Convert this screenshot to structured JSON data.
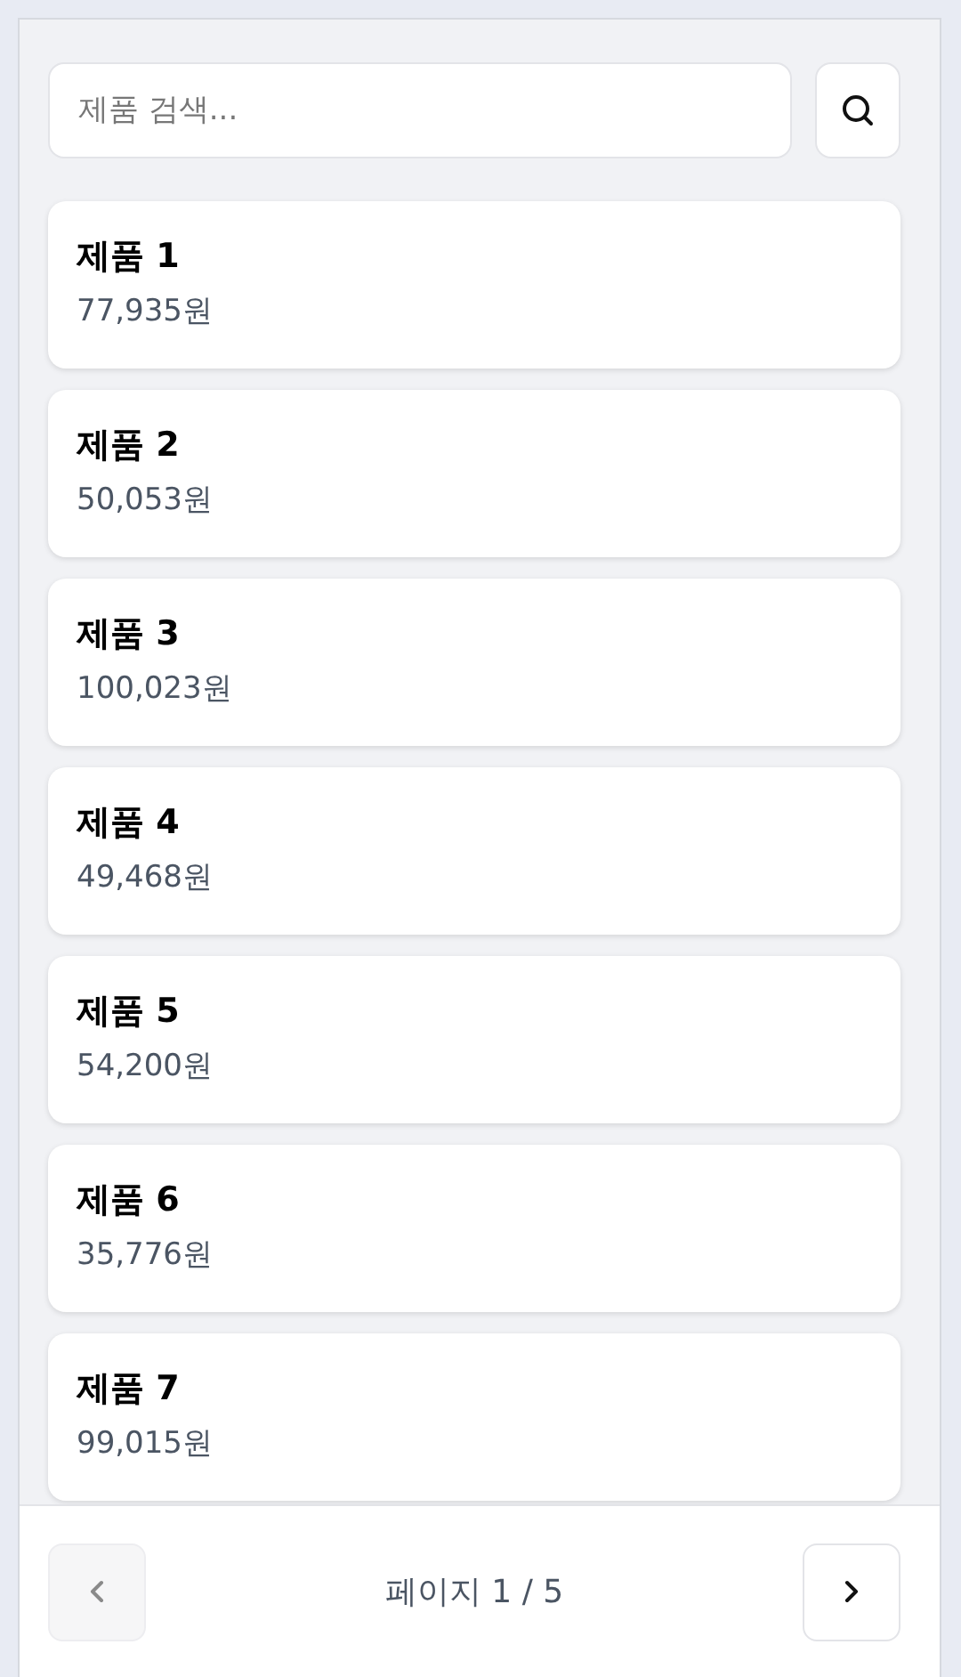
{
  "search": {
    "placeholder": "제품 검색..."
  },
  "products": [
    {
      "name": "제품 1",
      "price": "77,935원"
    },
    {
      "name": "제품 2",
      "price": "50,053원"
    },
    {
      "name": "제품 3",
      "price": "100,023원"
    },
    {
      "name": "제품 4",
      "price": "49,468원"
    },
    {
      "name": "제품 5",
      "price": "54,200원"
    },
    {
      "name": "제품 6",
      "price": "35,776원"
    },
    {
      "name": "제품 7",
      "price": "99,015원"
    }
  ],
  "pagination": {
    "label": "페이지 1 / 5",
    "prev": {
      "disabled": true
    },
    "next": {
      "disabled": false
    }
  }
}
